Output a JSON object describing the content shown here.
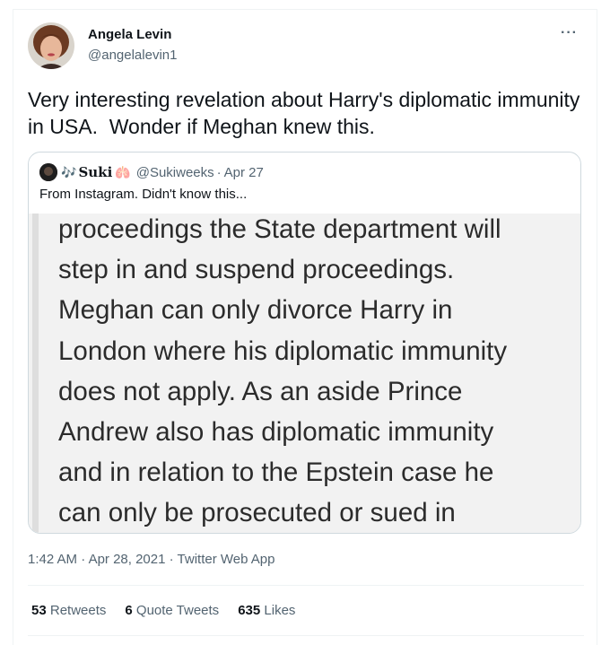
{
  "author": {
    "name": "Angela Levin",
    "handle": "@angelalevin1"
  },
  "more_label": "···",
  "tweet_text": "Very interesting revelation about Harry's diplomatic immunity in USA.  Wonder if Meghan knew this.",
  "quote": {
    "name": "Suki",
    "handle": "@Sukiweeks",
    "separator": "·",
    "date": "Apr 27",
    "note_icon": "🎶",
    "lungs_icon": "🫁",
    "text": "From Instagram. Didn't know this...",
    "image_lines": [
      "proceedings the State department will",
      "step in and suspend proceedings.",
      "Meghan can only divorce Harry in",
      "London where his diplomatic immunity",
      "does not apply. As an aside Prince",
      "Andrew also has diplomatic immunity",
      "and in relation to the Epstein case he",
      "can only be prosecuted or sued in"
    ]
  },
  "meta": {
    "time": "1:42 AM",
    "sep1": " · ",
    "date": "Apr 28, 2021",
    "sep2": " · ",
    "source": "Twitter Web App"
  },
  "stats": {
    "retweets_count": "53",
    "retweets_label": "Retweets",
    "quotes_count": "6",
    "quotes_label": "Quote Tweets",
    "likes_count": "635",
    "likes_label": "Likes"
  }
}
